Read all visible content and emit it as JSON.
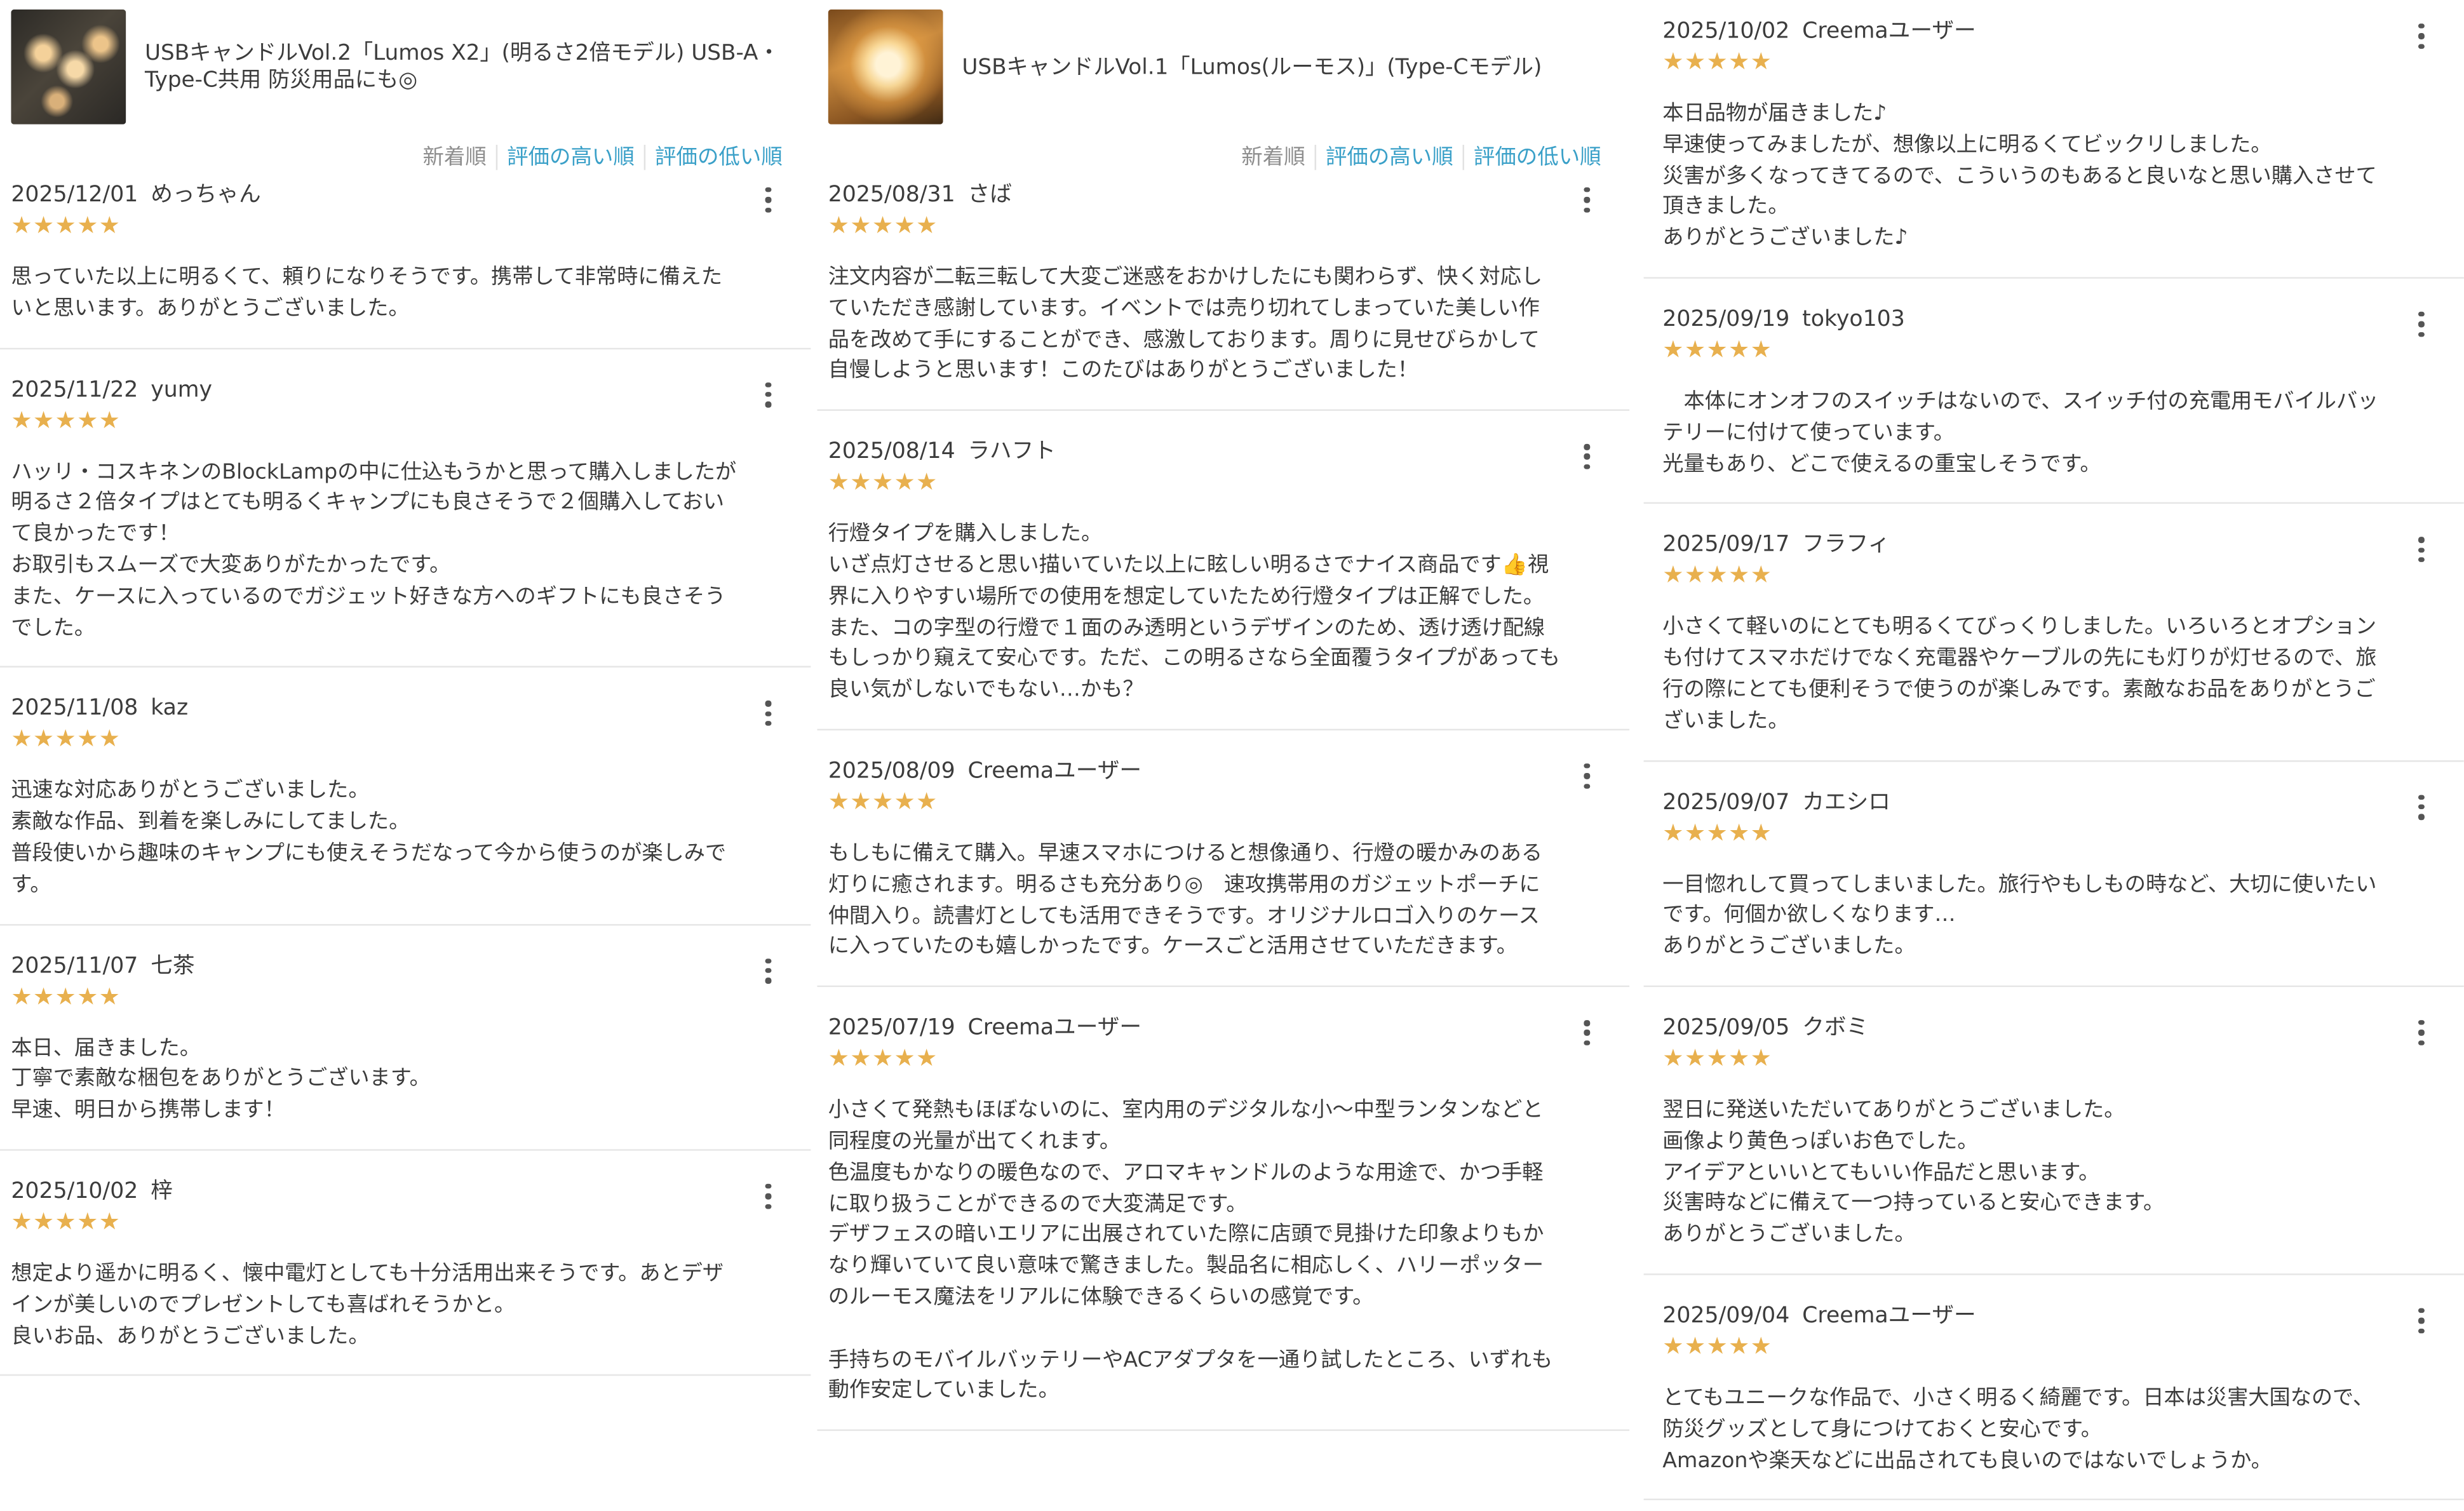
{
  "sort": {
    "newest": "新着順",
    "highest": "評価の高い順",
    "lowest": "評価の低い順"
  },
  "columns": [
    {
      "product": {
        "title": "USBキャンドルVol.2「Lumos X2」(明るさ2倍モデル) USB-A・Type-C共用 防災用品にも◎",
        "thumb_icon": "product-thumbnail-lumos-x2"
      },
      "reviews": [
        {
          "date": "2025/12/01",
          "name": "めっちゃん",
          "rating": 5,
          "text": "思っていた以上に明るくて、頼りになりそうです。携帯して非常時に備えたいと思います。ありがとうございました。"
        },
        {
          "date": "2025/11/22",
          "name": "yumy",
          "rating": 5,
          "text": "ハッリ・コスキネンのBlockLampの中に仕込もうかと思って購入しましたが明るさ２倍タイプはとても明るくキャンプにも良さそうで２個購入しておいて良かったです！\nお取引もスムーズで大変ありがたかったです。\nまた、ケースに入っているのでガジェット好きな方へのギフトにも良さそうでした。"
        },
        {
          "date": "2025/11/08",
          "name": "kaz",
          "rating": 5,
          "text": "迅速な対応ありがとうございました。\n素敵な作品、到着を楽しみにしてました。\n普段使いから趣味のキャンプにも使えそうだなって今から使うのが楽しみです。"
        },
        {
          "date": "2025/11/07",
          "name": "七茶",
          "rating": 5,
          "text": "本日、届きました。\n丁寧で素敵な梱包をありがとうございます。\n早速、明日から携帯します！"
        },
        {
          "date": "2025/10/02",
          "name": "梓",
          "rating": 5,
          "text": "想定より遥かに明るく、懐中電灯としても十分活用出来そうです。あとデザインが美しいのでプレゼントしても喜ばれそうかと。\n良いお品、ありがとうございました。"
        }
      ]
    },
    {
      "product": {
        "title": "USBキャンドルVol.1「Lumos(ルーモス)」(Type-Cモデル)",
        "thumb_icon": "product-thumbnail-lumos"
      },
      "reviews": [
        {
          "date": "2025/08/31",
          "name": "さば",
          "rating": 5,
          "text": "注文内容が二転三転して大変ご迷惑をおかけしたにも関わらず、快く対応していただき感謝しています。イベントでは売り切れてしまっていた美しい作品を改めて手にすることができ、感激しております。周りに見せびらかして自慢しようと思います！このたびはありがとうございました！"
        },
        {
          "date": "2025/08/14",
          "name": "ラハフト",
          "rating": 5,
          "text": "行燈タイプを購入しました。\nいざ点灯させると思い描いていた以上に眩しい明るさでナイス商品です👍視界に入りやすい場所での使用を想定していたため行燈タイプは正解でした。\nまた、コの字型の行燈で１面のみ透明というデザインのため、透け透け配線もしっかり窺えて安心です。ただ、この明るさなら全面覆うタイプがあっても良い気がしないでもない…かも？"
        },
        {
          "date": "2025/08/09",
          "name": "Creemaユーザー",
          "rating": 5,
          "text": "もしもに備えて購入。早速スマホにつけると想像通り、行燈の暖かみのある灯りに癒されます。明るさも充分あり◎　速攻携帯用のガジェットポーチに仲間入り。読書灯としても活用できそうです。オリジナルロゴ入りのケースに入っていたのも嬉しかったです。ケースごと活用させていただきます。"
        },
        {
          "date": "2025/07/19",
          "name": "Creemaユーザー",
          "rating": 5,
          "text": "小さくて発熱もほぼないのに、室内用のデジタルな小〜中型ランタンなどと同程度の光量が出てくれます。\n色温度もかなりの暖色なので、アロマキャンドルのような用途で、かつ手軽に取り扱うことができるので大変満足です。\nデザフェスの暗いエリアに出展されていた際に店頭で見掛けた印象よりもかなり輝いていて良い意味で驚きました。製品名に相応しく、ハリーポッターのルーモス魔法をリアルに体験できるくらいの感覚です。\n\n手持ちのモバイルバッテリーやACアダプタを一通り試したところ、いずれも動作安定していました。"
        }
      ]
    },
    {
      "reviews": [
        {
          "date": "2025/10/02",
          "name": "Creemaユーザー",
          "rating": 5,
          "text": "本日品物が届きました♪\n早速使ってみましたが、想像以上に明るくてビックリしました。\n災害が多くなってきてるので、こういうのもあると良いなと思い購入させて頂きました。\nありがとうございました♪"
        },
        {
          "date": "2025/09/19",
          "name": "tokyo103",
          "rating": 5,
          "text": "　本体にオンオフのスイッチはないので、スイッチ付の充電用モバイルバッテリーに付けて使っています。\n光量もあり、どこで使えるの重宝しそうです。"
        },
        {
          "date": "2025/09/17",
          "name": "フラフィ",
          "rating": 5,
          "text": "小さくて軽いのにとても明るくてびっくりしました。いろいろとオプションも付けてスマホだけでなく充電器やケーブルの先にも灯りが灯せるので、旅行の際にとても便利そうで使うのが楽しみです。素敵なお品をありがとうございました。"
        },
        {
          "date": "2025/09/07",
          "name": "カエシロ",
          "rating": 5,
          "text": "一目惚れして買ってしまいました。旅行やもしもの時など、大切に使いたいです。何個か欲しくなります…\nありがとうございました。"
        },
        {
          "date": "2025/09/05",
          "name": "クボミ",
          "rating": 5,
          "text": "翌日に発送いただいてありがとうございました。\n画像より黄色っぽいお色でした。\nアイデアといいとてもいい作品だと思います。\n災害時などに備えて一つ持っていると安心できます。\nありがとうございました。"
        },
        {
          "date": "2025/09/04",
          "name": "Creemaユーザー",
          "rating": 5,
          "text": "とてもユニークな作品で、小さく明るく綺麗です。日本は災害大国なので、防災グッズとして身につけておくと安心です。\nAmazonや楽天などに出品されても良いのではないでしょうか。"
        }
      ]
    }
  ],
  "colors": {
    "star": "#e8b04e",
    "link": "#3aa0c8",
    "muted": "#8e8e8e",
    "text": "#3c3c3c",
    "divider": "#e6e6e6"
  },
  "icons": {
    "star": "star-icon",
    "menu": "more-vertical-icon"
  }
}
